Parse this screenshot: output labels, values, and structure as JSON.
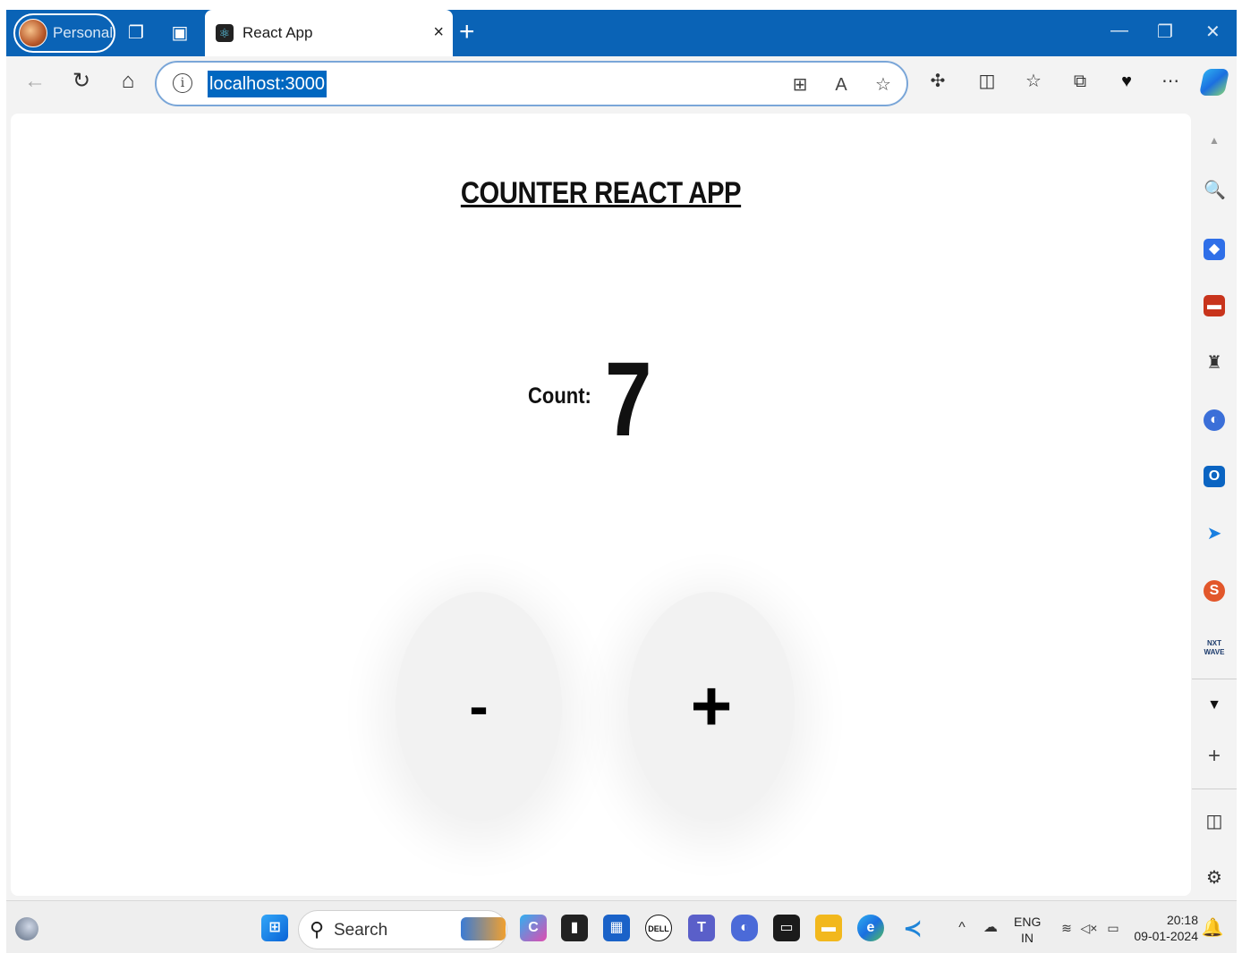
{
  "browser": {
    "profile_label": "Personal",
    "tab_title": "React App",
    "tab_close": "×",
    "new_tab": "+",
    "url": "localhost:3000"
  },
  "app": {
    "heading": "COUNTER REACT APP",
    "count_label": "Count:",
    "count_value": "7",
    "decrement_label": "-",
    "increment_label": "+"
  },
  "taskbar": {
    "search_label": "Search",
    "language_line1": "ENG",
    "language_line2": "IN",
    "time": "20:18",
    "date": "09-01-2024"
  },
  "colors": {
    "titlebar": "#0a63b6",
    "url_highlight": "#0067c0",
    "button_bg": "#f2f2f2"
  },
  "icons": {
    "titlebar": [
      "workspaces-icon",
      "vertical-tabs-icon",
      "react-favicon-icon",
      "minimize-icon",
      "restore-icon",
      "close-window-icon"
    ],
    "toolbar": [
      "back-icon",
      "refresh-icon",
      "home-icon",
      "site-info-icon",
      "app-available-icon",
      "read-aloud-icon",
      "favorite-star-icon",
      "extensions-icon",
      "split-screen-icon",
      "favorites-icon",
      "collections-icon",
      "browser-essentials-icon",
      "more-icon",
      "copilot-icon"
    ],
    "sidebar": [
      "search-icon",
      "shopping-icon",
      "tools-icon",
      "games-icon",
      "microsoft-365-icon",
      "outlook-icon",
      "drop-icon",
      "extension-s-icon",
      "nxtwave-icon",
      "scroll-down-icon",
      "add-icon",
      "sidebar-toggle-icon",
      "settings-icon"
    ]
  }
}
